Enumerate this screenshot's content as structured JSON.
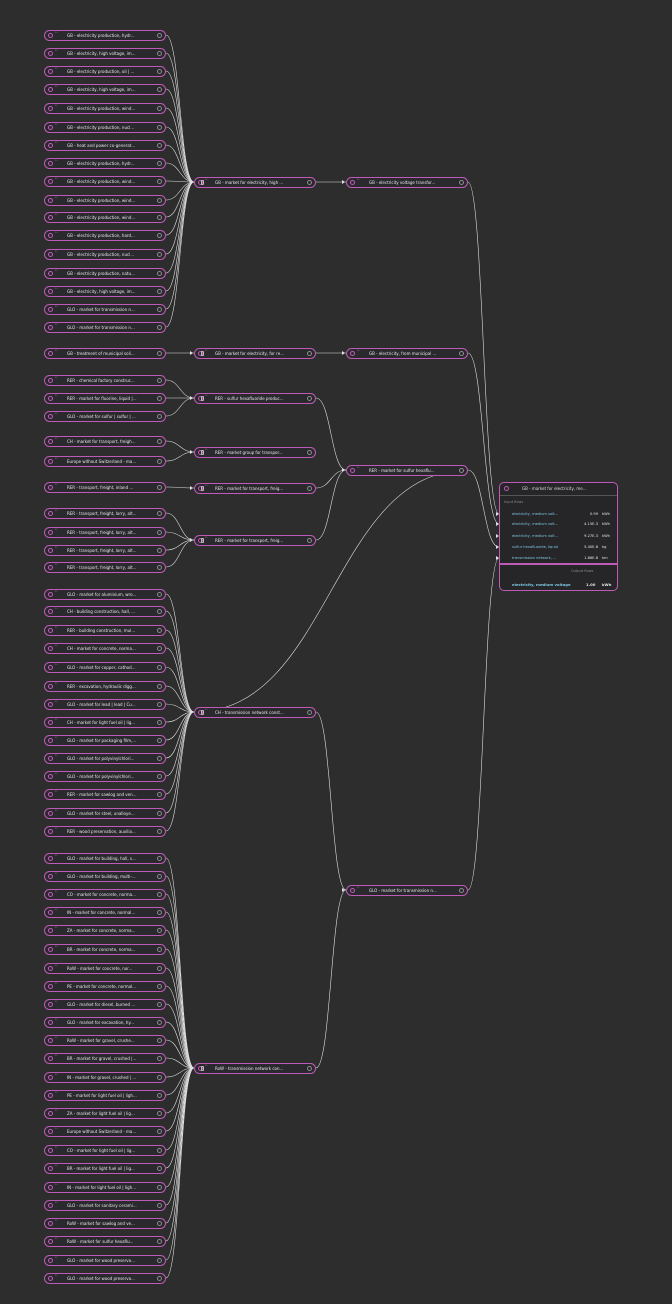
{
  "colors": {
    "node_border": "#c05ab8",
    "edge": "#e0e0e0",
    "flow_text": "#7ec8e3",
    "background": "#2d2d2d"
  },
  "col1": [
    "GB - electricity production, hydr...",
    "GB - electricity, high voltage, im...",
    "GB - electricity production, oil | ...",
    "GB - electricity, high voltage, im...",
    "GB - electricity production, wind...",
    "GB - electricity production, nucl...",
    "GB - heat and power co-generat...",
    "GB - electricity production, hydr...",
    "GB - electricity production, wind...",
    "GB - electricity production, wind...",
    "GB - electricity production, wind...",
    "GB - electricity production, hard...",
    "GB - electricity production, nucl...",
    "GB - electricity production, natu...",
    "GB - electricity, high voltage, im...",
    "GLO - market for transmission n...",
    "GLO - market for transmission n...",
    "GB - treatment of municipal soli...",
    "RER - chemical factory construc...",
    "RER - market for fluorine, liquid |...",
    "GLO - market for sulfur | sulfur | ...",
    "CH - market for transport, freigh...",
    "Europe without Switzerland - ma...",
    "RER - transport, freight, inland ...",
    "RER - transport, freight, lorry, alt...",
    "RER - transport, freight, lorry, alt...",
    "RER - transport, freight, lorry, alt...",
    "RER - transport, freight, lorry, alt...",
    "GLO - market for aluminium, wro...",
    "CH - building construction, hall, ...",
    "RER - building construction, mul...",
    "CH - market for concrete, norma...",
    "GLO - market for copper, cathod...",
    "RER - excavation, hydraulic digg...",
    "GLO - market for lead | lead | Cu...",
    "CH - market for light fuel oil | lig...",
    "GLO - market for packaging film,...",
    "GLO - market for polyvinylchlori...",
    "GLO - market for polyvinylchlori...",
    "RER - market for sawlog and ven...",
    "GLO - market for steel, unalloye...",
    "RER - wood preservation, auxilia...",
    "GLO - market for building, hall, s...",
    "GLO - market for building, multi-...",
    "CO - market for concrete, norma...",
    "IN - market for concrete, normal...",
    "ZA - market for concrete, norma...",
    "BR - market for concrete, norma...",
    "RoW - market for concrete, nor...",
    "PE - market for concrete, normal...",
    "GLO - market for diesel, burned ...",
    "GLO - market for excavation, hy...",
    "RoW - market for gravel, crushe...",
    "BR - market for gravel, crushed |...",
    "IN - market for gravel, crushed | ...",
    "PE - market for light fuel oil | ligh...",
    "ZA - market for light fuel oil | lig...",
    "Europe without Switzerland - ma...",
    "CO - market for light fuel oil | lig...",
    "BR - market for light fuel oil | lig...",
    "IN - market for light fuel oil | ligh...",
    "GLO - market for sanitary cerami...",
    "RoW - market for sawlog and ve...",
    "RoW - market for sulfur hexaflu...",
    "GLO - market for wood preserva...",
    "GLO - market for wood preserva..."
  ],
  "col2": [
    "GB - market for electricity, high ...",
    "GB - market for electricity, for re...",
    "RER - sulfur hexafluoride produc...",
    "RER - market group for transpor...",
    "RER - market for transport, freig...",
    "RER - market for transport, freig...",
    "CH - transmission network const...",
    "RoW - transmission network con..."
  ],
  "col3": [
    "GB - electricity voltage transfor...",
    "GB - electricity, from municipal ...",
    "RER - market for sulfur hexaflu...",
    "GLO - market for transmission n..."
  ],
  "process": {
    "title": "GB - market for electricity, me...",
    "input_label": "Input flows",
    "inputs": [
      {
        "name": "electricity, medium volt...",
        "amount": "0.99",
        "unit": "kWh"
      },
      {
        "name": "electricity, medium volt...",
        "amount": "4.15E-3",
        "unit": "kWh"
      },
      {
        "name": "electricity, medium volt...",
        "amount": "9.27E-3",
        "unit": "kWh"
      },
      {
        "name": "sulfur hexafluoride, liquid",
        "amount": "5.40E-8",
        "unit": "kg"
      },
      {
        "name": "transmission network, ...",
        "amount": "1.86E-8",
        "unit": "km"
      }
    ],
    "output_label": "Output flows",
    "output": {
      "name": "electricity, medium voltage",
      "amount": "1.00",
      "unit": "kWh"
    }
  }
}
